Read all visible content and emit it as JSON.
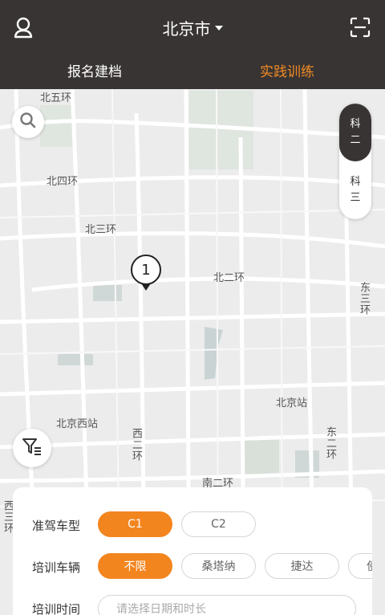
{
  "header": {
    "city": "北京市",
    "tabs": [
      {
        "label": "报名建档",
        "active": false
      },
      {
        "label": "实践训练",
        "active": true
      }
    ],
    "accent_color": "#f08a26",
    "background_color": "#383433"
  },
  "map": {
    "road_labels": [
      "北五环",
      "北四环",
      "北三环",
      "北二环",
      "东三环",
      "北京站",
      "北京西站",
      "西二环",
      "东二环",
      "南二环",
      "西三环"
    ],
    "marker_count": "1"
  },
  "subject_toggle": {
    "options": [
      {
        "line1": "科",
        "line2": "二",
        "active": true
      },
      {
        "line1": "科",
        "line2": "三",
        "active": false
      }
    ]
  },
  "filters": {
    "license_label": "准驾车型",
    "license_options": [
      {
        "label": "C1",
        "active": true
      },
      {
        "label": "C2",
        "active": false
      }
    ],
    "vehicle_label": "培训车辆",
    "vehicle_options": [
      {
        "label": "不限",
        "active": true
      },
      {
        "label": "桑塔纳",
        "active": false
      },
      {
        "label": "捷达",
        "active": false
      },
      {
        "label": "使",
        "active": false
      }
    ],
    "time_label": "培训时间",
    "time_placeholder": "请选择日期和时长"
  },
  "icons": [
    "user-icon",
    "caret-down-icon",
    "scan-icon",
    "search-icon",
    "filter-icon",
    "map-marker-icon"
  ]
}
